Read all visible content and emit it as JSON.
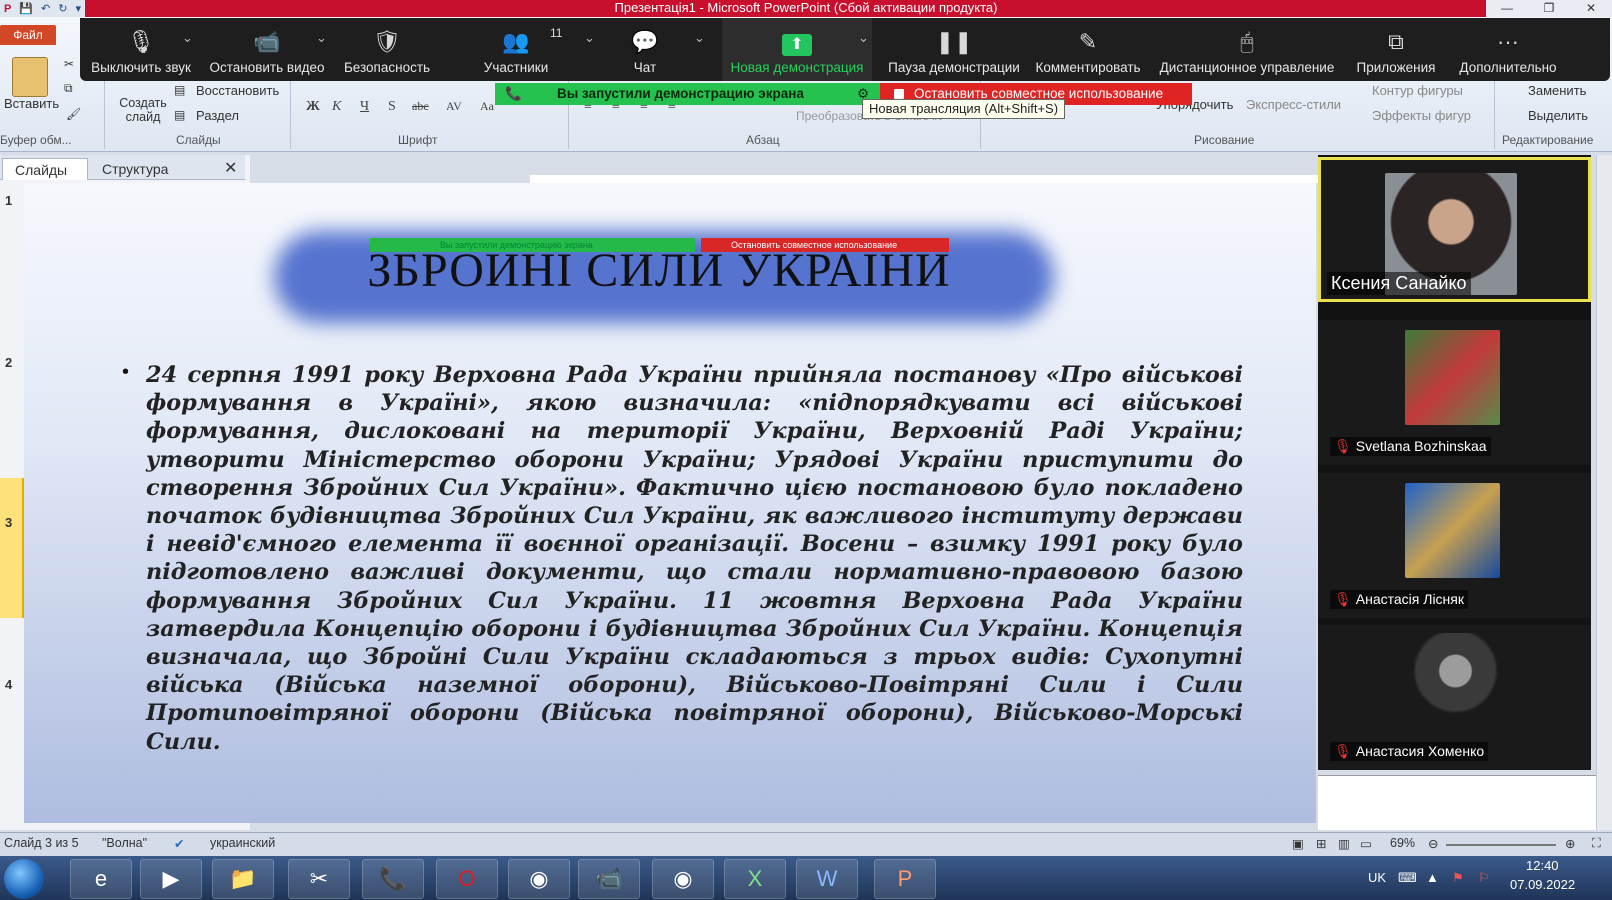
{
  "window": {
    "title": "Презентація1 - Microsoft PowerPoint (Сбой активации продукта)"
  },
  "ribbon": {
    "file_tab": "Файл",
    "paste": "Вставить",
    "clipboard_group": "Буфер обм...",
    "create_slide": "Создать слайд",
    "restore": "Восстановить",
    "section": "Раздел",
    "slides_group": "Слайды",
    "font_group": "Шрифт",
    "paragraph_group": "Абзац",
    "convert": "Преобразовать в SmartArt",
    "arrange": "Упорядочить",
    "express_styles": "Экспресс-стили",
    "shape_outline": "Контур фигуры",
    "shape_effects": "Эффекты фигур",
    "drawing_group": "Рисование",
    "replace": "Заменить",
    "select": "Выделить",
    "editing_group": "Редактирование"
  },
  "zoom_toolbar": {
    "mute": "Выключить звук",
    "stop_video": "Остановить видео",
    "security": "Безопасность",
    "participants": "Участники",
    "participants_count": "11",
    "chat": "Чат",
    "new_share": "Новая демонстрация",
    "pause_share": "Пауза демонстрации",
    "annotate": "Комментировать",
    "remote_control": "Дистанционное управление",
    "apps": "Приложения",
    "more": "Дополнительно"
  },
  "share_banner": {
    "started": "Вы запустили демонстрацию экрана",
    "stop": "Остановить совместное использование",
    "tooltip": "Новая трансляция (Alt+Shift+S)"
  },
  "slides_panel": {
    "tab_slides": "Слайды",
    "tab_outline": "Структура",
    "slide_numbers": [
      "1",
      "2",
      "3",
      "4"
    ]
  },
  "slide": {
    "title": "ЗБРОЙНІ СИЛИ УКРАЇНИ",
    "mini_green": "Вы запустили демонстрацию экрана",
    "mini_red": "Остановить совместное использование",
    "body": "24 серпня 1991 року Верховна Рада України прийняла постанову «Про військові формування в Україні», якою визначила: «підпорядкувати всі військові формування, дислоковані на території України, Верховній Раді України; утворити Міністерство оборони України; Урядові України приступити до створення Збройних Сил України». Фактично цією постановою було покладено початок будівництва Збройних Сил України, як важливого інституту держави і невід'ємного елемента її воєнної організації. Восени – взимку 1991 року було підготовлено важливі документи, що стали нормативно-правовою базою формування Збройних Сил України. 11 жовтня Верховна Рада України затвердила Концепцію оборони і будівництва Збройних Сил України. Концепція визначала, що Збройні Сили України складаються з трьох видів: Сухопутні війська (Війська наземної оборони), Військово-Повітряні Сили і Сили Протиповітряної оборони (Війська повітряної оборони), Військово-Морські Сили."
  },
  "participants": [
    {
      "name": "Ксения Санайко",
      "muted": false,
      "active": true
    },
    {
      "name": "Svetlana Bozhinskaa",
      "muted": true,
      "active": false
    },
    {
      "name": "Анастасія Лісняк",
      "muted": true,
      "active": false
    },
    {
      "name": "Анастасия Хоменко",
      "muted": true,
      "active": false
    }
  ],
  "status_bar": {
    "slide_info": "Слайд 3 из 5",
    "theme": "\"Волна\"",
    "language": "украинский",
    "zoom": "69%"
  },
  "taskbar": {
    "lang": "UK",
    "time": "12:40",
    "date": "07.09.2022"
  },
  "colors": {
    "title_bar": "#c8102e",
    "zoom_green": "#22c55e",
    "zoom_red": "#e02424",
    "active_speaker": "#e9e04d"
  }
}
